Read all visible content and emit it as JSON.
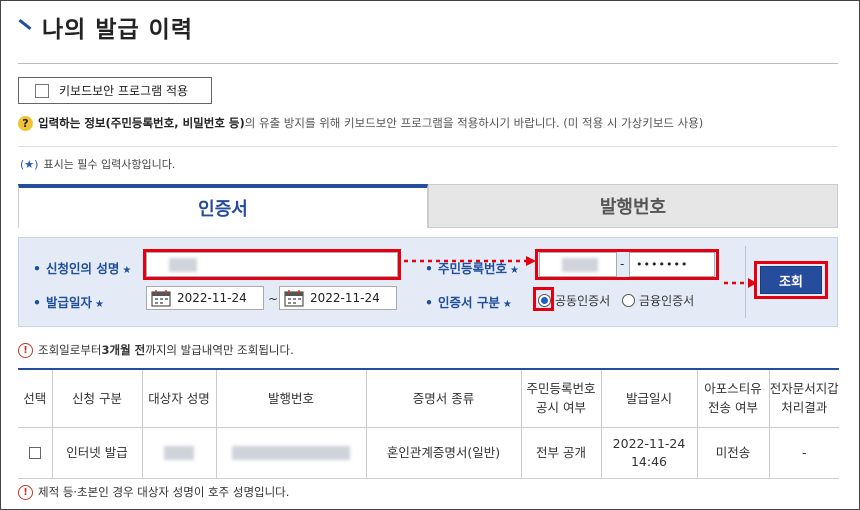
{
  "page": {
    "title": "나의 발급 이력"
  },
  "keyboard_security": {
    "button_label": "키보드보안 프로그램 적용",
    "help_icon": "question-icon",
    "help_bold": "입력하는 정보(주민등록번호, 비밀번호 등)",
    "help_rest": "의 유출 방지를 위해 키보드보안 프로그램을 적용하시기 바랍니다. (미 적용 시 가상키보드 사용)"
  },
  "required_note": {
    "mark": "(★)",
    "text": "표시는 필수 입력사항입니다."
  },
  "tabs": [
    {
      "label": "인증서",
      "active": true
    },
    {
      "label": "발행번호",
      "active": false
    }
  ],
  "form": {
    "applicant_name_label": "신청인의 성명",
    "ssn_label": "주민등록번호",
    "ssn_hyphen": "-",
    "ssn_back_masked": "•••••••",
    "issue_date_label": "발급일자",
    "date_from": "2022-11-24",
    "date_tilde": "~",
    "date_to": "2022-11-24",
    "cert_type_label": "인증서 구분",
    "cert_options": [
      {
        "label": "공동인증서",
        "selected": true
      },
      {
        "label": "금융인증서",
        "selected": false
      }
    ],
    "search_button": "조회",
    "required_mark": "★",
    "bullet": "•"
  },
  "notices": {
    "query_period_pre": "조회일로부터 ",
    "query_period_bold": "3개월 전",
    "query_period_post": "까지의 발급내역만 조회됩니다.",
    "name_note": "제적 등·초본인 경우 대상자 성명이 호주 성명입니다.",
    "icon": "exclamation-icon"
  },
  "table": {
    "headers": [
      "선택",
      "신청 구분",
      "대상자 성명",
      "발행번호",
      "증명서 종류",
      "주민등록번호\n공시 여부",
      "발급일시",
      "아포스티유\n전송 여부",
      "전자문서지갑\n처리결과"
    ],
    "rows": [
      {
        "type": "인터넷 발급",
        "cert_kind": "혼인관계증명서(일반)",
        "ssn_disclosure": "전부 공개",
        "issued_date": "2022-11-24",
        "issued_time": "14:46",
        "apostille": "미전송",
        "wallet_result": "-"
      }
    ]
  },
  "colors": {
    "brand_blue": "#264c9c",
    "highlight_red": "#e30010",
    "form_bg": "#e4ebf6"
  }
}
